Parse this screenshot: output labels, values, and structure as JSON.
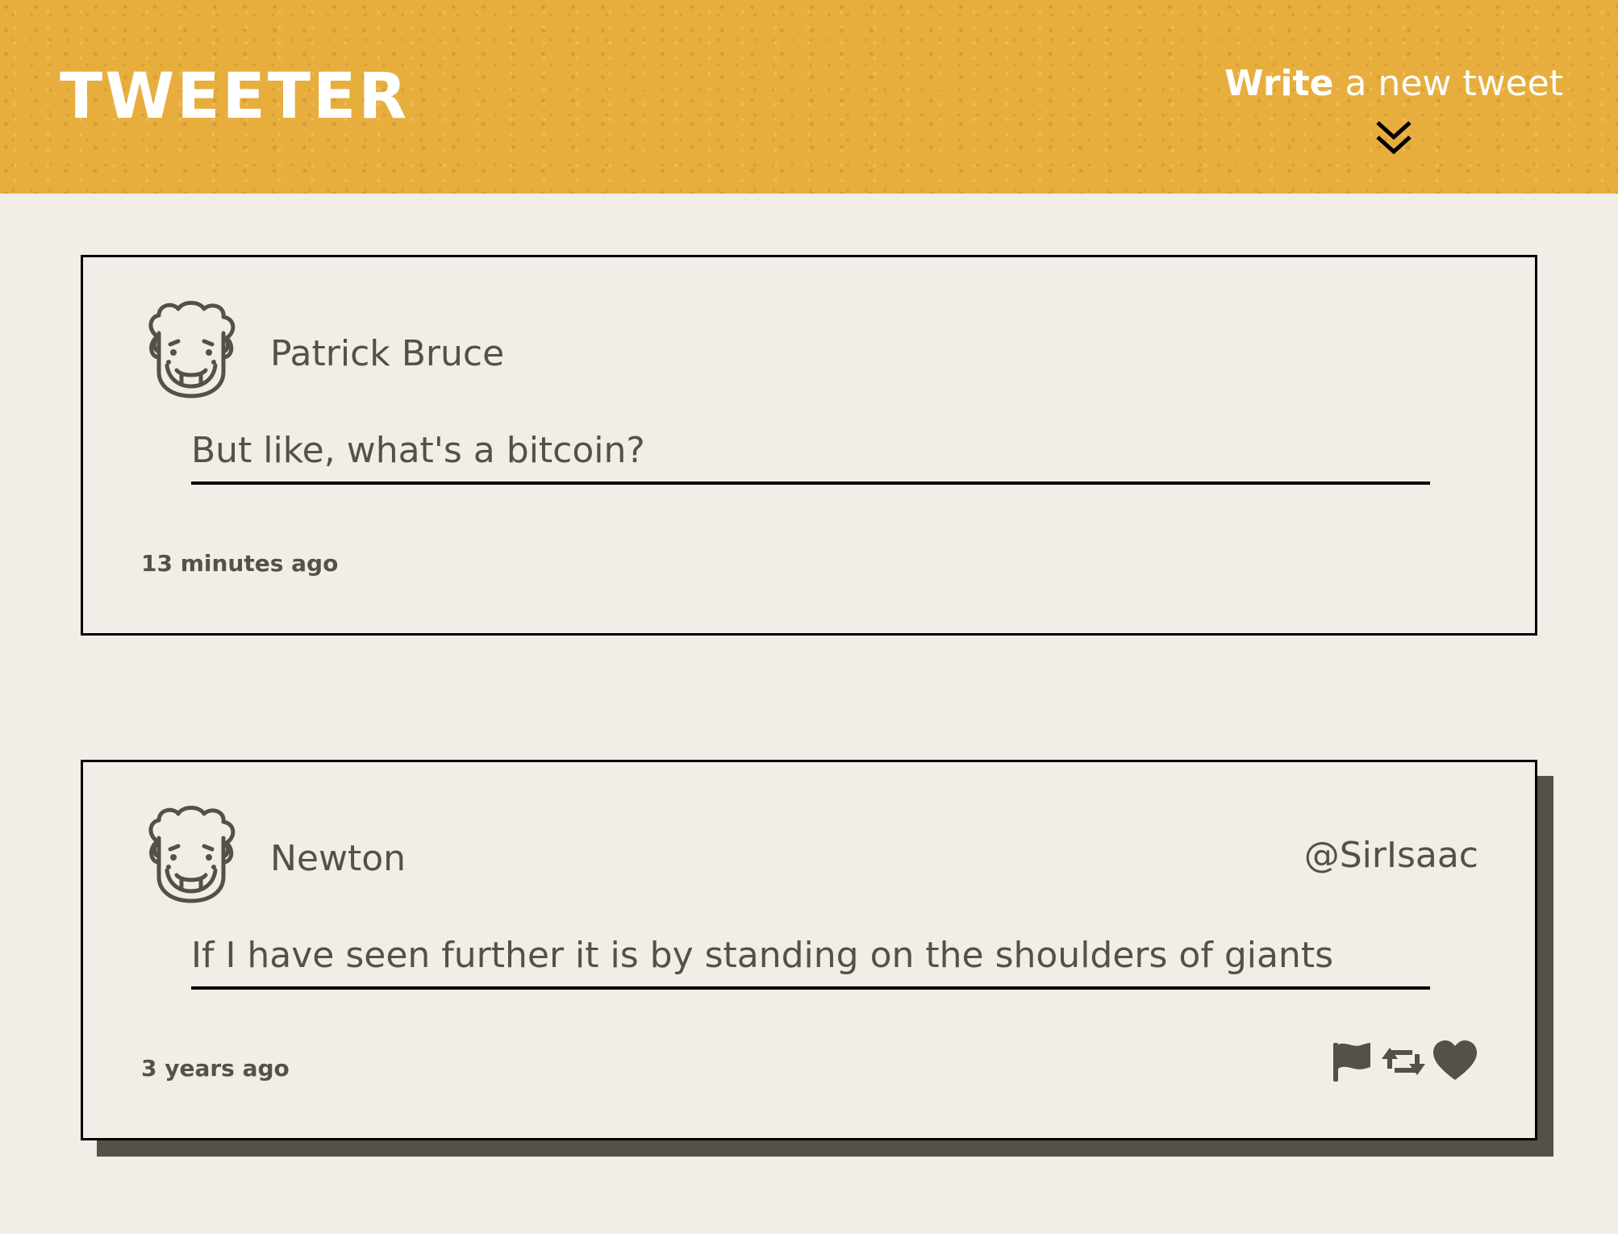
{
  "header": {
    "logo": "TWEETER",
    "compose_bold": "Write",
    "compose_rest": " a new tweet",
    "background_color": "#e7ae3e",
    "icon": "double-chevron-down-icon"
  },
  "tweets": [
    {
      "author": "Patrick Bruce",
      "handle": "",
      "content": "But like, what's a bitcoin?",
      "time": "13 minutes ago",
      "actions_visible": false
    },
    {
      "author": "Newton",
      "handle": "@SirIsaac",
      "content": "If I have seen further it is by standing on the shoulders of giants",
      "time": "3 years ago",
      "actions_visible": true,
      "actions": [
        "flag-icon",
        "retweet-icon",
        "heart-icon"
      ]
    }
  ],
  "colors": {
    "page_background": "#f1ede7",
    "text": "#545149",
    "border": "#000000",
    "shadow": "#545149"
  }
}
